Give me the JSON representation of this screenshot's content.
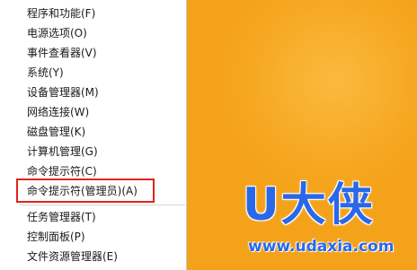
{
  "menu": {
    "items": [
      {
        "label": "程序和功能(F)"
      },
      {
        "label": "电源选项(O)"
      },
      {
        "label": "事件查看器(V)"
      },
      {
        "label": "系统(Y)"
      },
      {
        "label": "设备管理器(M)"
      },
      {
        "label": "网络连接(W)"
      },
      {
        "label": "磁盘管理(K)"
      },
      {
        "label": "计算机管理(G)"
      },
      {
        "label": "命令提示符(C)"
      },
      {
        "label": "命令提示符(管理员)(A)"
      },
      {
        "label": "任务管理器(T)"
      },
      {
        "label": "控制面板(P)"
      },
      {
        "label": "文件资源管理器(E)"
      }
    ],
    "highlighted_index": 9
  },
  "watermark": {
    "brand": "U大侠",
    "url": "www.udaxia.com"
  },
  "colors": {
    "desktop_background": "#f4a21a",
    "highlight_border": "#e0231c",
    "brand_blue": "#2a68e8"
  }
}
